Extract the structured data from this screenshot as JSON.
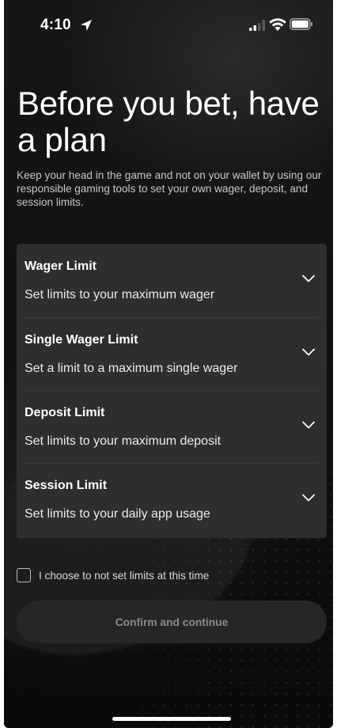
{
  "status_bar": {
    "time": "4:10",
    "icons": [
      "location-arrow-icon",
      "cellular-signal-icon",
      "wifi-icon",
      "battery-icon"
    ]
  },
  "headline": "Before you bet, have a plan",
  "intro": "Keep your head in the game and not on your wallet by using our responsible gaming tools to set your own wager, deposit, and session limits.",
  "limits": [
    {
      "title": "Wager Limit",
      "description": "Set limits to your maximum wager"
    },
    {
      "title": "Single Wager Limit",
      "description": "Set a limit to a maximum single wager"
    },
    {
      "title": "Deposit Limit",
      "description": "Set limits to your maximum deposit"
    },
    {
      "title": "Session Limit",
      "description": "Set limits to your daily app usage"
    }
  ],
  "optout": {
    "label": "I choose to not set limits at this time",
    "checked": false
  },
  "confirm_button": {
    "label": "Confirm and continue",
    "enabled": false
  },
  "colors": {
    "background": "#0c0c0c",
    "panel": "#2e2e2e",
    "button_disabled_bg": "#262626",
    "button_disabled_text": "#8a8a8a",
    "text_primary": "#ffffff"
  }
}
